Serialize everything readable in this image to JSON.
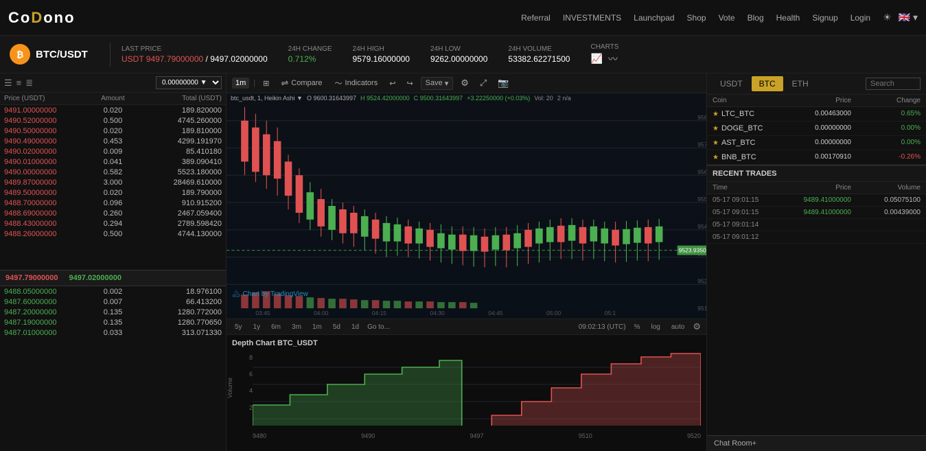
{
  "topnav": {
    "logo": "CoDono",
    "logo_c": "Co",
    "logo_rest": "Dono",
    "nav_items": [
      "Referral",
      "INVESTMENTS",
      "Launchpad",
      "Shop",
      "Vote",
      "Blog",
      "Health",
      "Signup",
      "Login"
    ]
  },
  "ticker": {
    "pair": "BTC/USDT",
    "last_price_label": "LAST PRICE",
    "last_price_red": "USDT 9497.79000000",
    "last_price_sep": "/",
    "last_price_white": "9497.02000000",
    "change_label": "24H CHANGE",
    "change_value": "0.712%",
    "high_label": "24H HIGH",
    "high_value": "9579.16000000",
    "low_label": "24H LOW",
    "low_value": "9262.00000000",
    "volume_label": "24H Volume",
    "volume_value": "53382.62271500",
    "charts_label": "CHARTS"
  },
  "orderbook": {
    "amount_select": "0.00000000 ▼",
    "headers": [
      "Price (USDT)",
      "Amount",
      "Total (USDT)"
    ],
    "sell_rows": [
      {
        "price": "9491.00000000",
        "amount": "0.020",
        "total": "189.820000"
      },
      {
        "price": "9490.52000000",
        "amount": "0.500",
        "total": "4745.260000"
      },
      {
        "price": "9490.50000000",
        "amount": "0.020",
        "total": "189.810000"
      },
      {
        "price": "9490.49000000",
        "amount": "0.453",
        "total": "4299.191970"
      },
      {
        "price": "9490.02000000",
        "amount": "0.009",
        "total": "85.410180"
      },
      {
        "price": "9490.01000000",
        "amount": "0.041",
        "total": "389.090410"
      },
      {
        "price": "9490.00000000",
        "amount": "0.582",
        "total": "5523.180000"
      },
      {
        "price": "9489.87000000",
        "amount": "3.000",
        "total": "28469.610000"
      },
      {
        "price": "9489.50000000",
        "amount": "0.020",
        "total": "189.790000"
      },
      {
        "price": "9488.70000000",
        "amount": "0.096",
        "total": "910.915200"
      },
      {
        "price": "9488.69000000",
        "amount": "0.260",
        "total": "2467.059400"
      },
      {
        "price": "9488.43000000",
        "amount": "0.294",
        "total": "2789.598420"
      },
      {
        "price": "9488.26000000",
        "amount": "0.500",
        "total": "4744.130000"
      }
    ],
    "mid_price1": "9497.79000000",
    "mid_price2": "9497.02000000",
    "buy_rows": [
      {
        "price": "9488.05000000",
        "amount": "0.002",
        "total": "18.976100"
      },
      {
        "price": "9487.60000000",
        "amount": "0.007",
        "total": "66.413200"
      },
      {
        "price": "9487.20000000",
        "amount": "0.135",
        "total": "1280.772000"
      },
      {
        "price": "9487.19000000",
        "amount": "0.135",
        "total": "1280.770650"
      },
      {
        "price": "9487.01000000",
        "amount": "0.033",
        "total": "313.071330"
      }
    ]
  },
  "chart": {
    "timeframes": [
      "1m",
      "5d",
      "1y",
      "6m",
      "3m",
      "1m",
      "5d",
      "1d"
    ],
    "active_tf": "1m",
    "compare_btn": "Compare",
    "indicators_btn": "Indicators",
    "save_btn": "Save",
    "ohlc_pair": "btc_usdt, 1, Heikin Ashi ▼",
    "ohlc_o": "O 9600.31643997",
    "ohlc_h": "H 9524.42000000",
    "ohlc_c": "C 9500.31643997",
    "ohlc_chg": "+3.22250000 (+0.03%)",
    "vol_label": "Vol: 20",
    "na_label": "2 n/a",
    "current_price": "9523.93500000",
    "bottom_tfs": [
      "5y",
      "1y",
      "6m",
      "3m",
      "1m",
      "5d",
      "1d"
    ],
    "go_to": "Go to...",
    "time_utc": "09:02:13 (UTC)",
    "log_btn": "log",
    "auto_btn": "auto",
    "percent_btn": "%"
  },
  "depth_chart": {
    "title": "Depth Chart BTC_USDT",
    "y_labels": [
      "8",
      "6",
      "4",
      "2"
    ],
    "x_labels": [
      "9480",
      "9490",
      "9497",
      "9510",
      "9520"
    ]
  },
  "right_panel": {
    "tabs": [
      "USDT",
      "BTC",
      "ETH"
    ],
    "active_tab": "BTC",
    "search_placeholder": "Search",
    "col_headers": [
      "Coin",
      "Price",
      "Change"
    ],
    "coins": [
      {
        "star": "★",
        "name": "LTC_BTC",
        "price": "0.00463000",
        "change": "0.65%",
        "change_dir": "pos"
      },
      {
        "star": "★",
        "name": "DOGE_BTC",
        "price": "0.00000000",
        "change": "0.00%",
        "change_dir": "pos"
      },
      {
        "star": "★",
        "name": "AST_BTC",
        "price": "0.00000000",
        "change": "0.00%",
        "change_dir": "pos"
      },
      {
        "star": "★",
        "name": "BNB_BTC",
        "price": "0.00170910",
        "change": "-0.26%",
        "change_dir": "neg"
      }
    ],
    "recent_trades_label": "RECENT TRADES",
    "rt_col_headers": [
      "Time",
      "Price",
      "Volume"
    ],
    "trades": [
      {
        "time": "05-17 09:01:15",
        "price": "9489.41000000",
        "volume": "0.05075100"
      },
      {
        "time": "05-17 09:01:15",
        "price": "9489.41000000",
        "volume": "0.00439000"
      },
      {
        "time": "05-17 09:01:14",
        "price": "",
        "volume": ""
      },
      {
        "time": "05-17 09:01:12",
        "price": "",
        "volume": ""
      }
    ],
    "chat_room_btn": "Chat Room+"
  }
}
